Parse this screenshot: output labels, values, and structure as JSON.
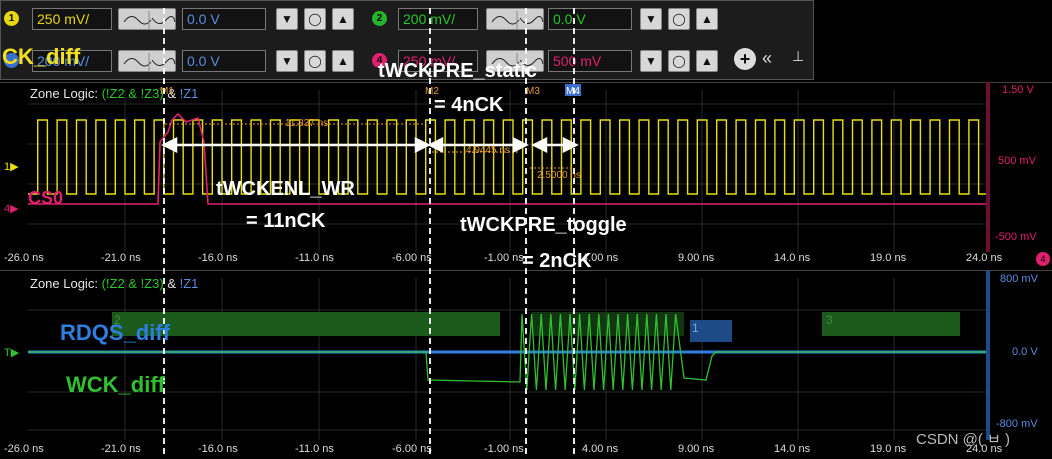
{
  "controls": {
    "ch1": {
      "num": "1",
      "color": "#e8d810",
      "scale": "250 mV/",
      "offset": "0.0 V"
    },
    "ch2": {
      "num": "2",
      "color": "#28b428",
      "scale": "200 mV/",
      "offset": "0.0 V"
    },
    "ch3": {
      "scale": "200 mV/",
      "offset": "0.0 V"
    },
    "ch4": {
      "num": "4",
      "color": "#e0206e",
      "scale": "250 mV/",
      "offset": "500 mV"
    },
    "icons": {
      "dec": "down-triangle",
      "zero": "circle",
      "inc": "up-triangle",
      "add": "plus",
      "collapse": "double-chevron-left",
      "pin": "pin"
    }
  },
  "panel_top": {
    "zone_logic_label": "Zone Logic:",
    "zone_expr": "(!Z2 & !Z3)",
    "zone_and": "&",
    "zone_z1": "!Z1",
    "right_axis": [
      "1.50 V",
      "500 mV",
      "-500 mV"
    ],
    "x_ticks": [
      "-26.0 ns",
      "-21.0 ns",
      "-16.0 ns",
      "-11.0 ns",
      "-6.00 ns",
      "-1.00 ns",
      "4.00 ns",
      "9.00 ns",
      "14.0 ns",
      "19.0 ns",
      "24.0 ns"
    ],
    "markers": [
      "M1",
      "M2",
      "M3",
      "M4"
    ],
    "measurements": [
      "11.837 ns",
      "4.9445 ns",
      "2.5000 ns"
    ]
  },
  "panel_bottom": {
    "zone_logic_label": "Zone Logic:",
    "zone_expr": "(!Z2 & !Z3)",
    "zone_and": "&",
    "zone_z1": "!Z1",
    "right_axis": [
      "800 mV",
      "0.0 V",
      "-800 mV"
    ],
    "x_ticks": [
      "-26.0 ns",
      "-21.0 ns",
      "-16.0 ns",
      "-11.0 ns",
      "-6.00 ns",
      "-1.00 ns",
      "4.00 ns",
      "9.00 ns",
      "14.0 ns",
      "19.0 ns",
      "24.0 ns"
    ],
    "zones": [
      "2",
      "1",
      "3"
    ]
  },
  "annotations": {
    "ck_diff": "CK_diff",
    "cs0": "CS0",
    "tWCKPRE_static": "tWCKPRE_static",
    "eq_4nck": "= 4nCK",
    "tWCKENL_WR": "tWCKENL_WR",
    "eq_11nck": "=  11nCK",
    "tWCKPRE_toggle": "tWCKPRE_toggle",
    "eq_2nck": "= 2nCK",
    "rdqs_diff": "RDQS_diff",
    "wck_diff": "WCK_diff"
  },
  "watermark": "CSDN @(    ㅂ )"
}
